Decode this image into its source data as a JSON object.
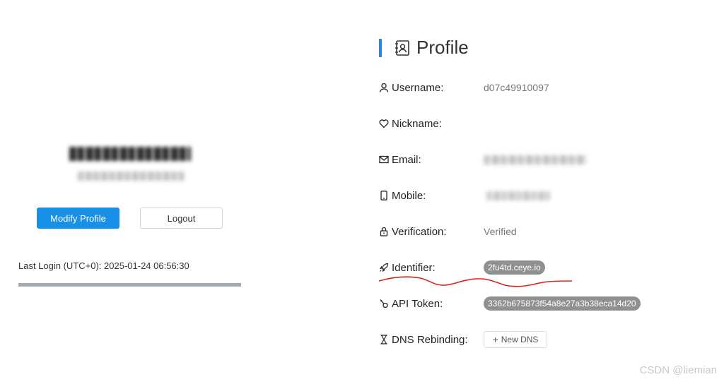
{
  "left_panel": {
    "modify_profile_label": "Modify Profile",
    "logout_label": "Logout",
    "last_login": "Last Login (UTC+0): 2025-01-24 06:56:30"
  },
  "profile": {
    "title": "Profile",
    "fields": [
      {
        "label": "Username:",
        "value": "d07c49910097",
        "icon": "user-icon"
      },
      {
        "label": "Nickname:",
        "value": "",
        "icon": "heart-icon"
      },
      {
        "label": "Email:",
        "value": "",
        "icon": "mail-icon"
      },
      {
        "label": "Mobile:",
        "value": "",
        "icon": "mobile-icon"
      },
      {
        "label": "Verification:",
        "value": "Verified",
        "icon": "lock-icon"
      },
      {
        "label": "Identifier:",
        "value": "2fu4td.ceye.io",
        "icon": "rocket-icon"
      },
      {
        "label": "API Token:",
        "value": "3362b675873f54a8e27a3b38eca14d20",
        "icon": "token-icon"
      },
      {
        "label": "DNS Rebinding:",
        "value": "",
        "icon": "hourglass-icon"
      }
    ],
    "new_dns_label": "New DNS"
  },
  "watermark": "CSDN @liemian",
  "colors": {
    "primary": "#1890e8",
    "accent_bar": "#2a87e2",
    "pill": "#8f9092",
    "annotation": "#e0201c"
  }
}
